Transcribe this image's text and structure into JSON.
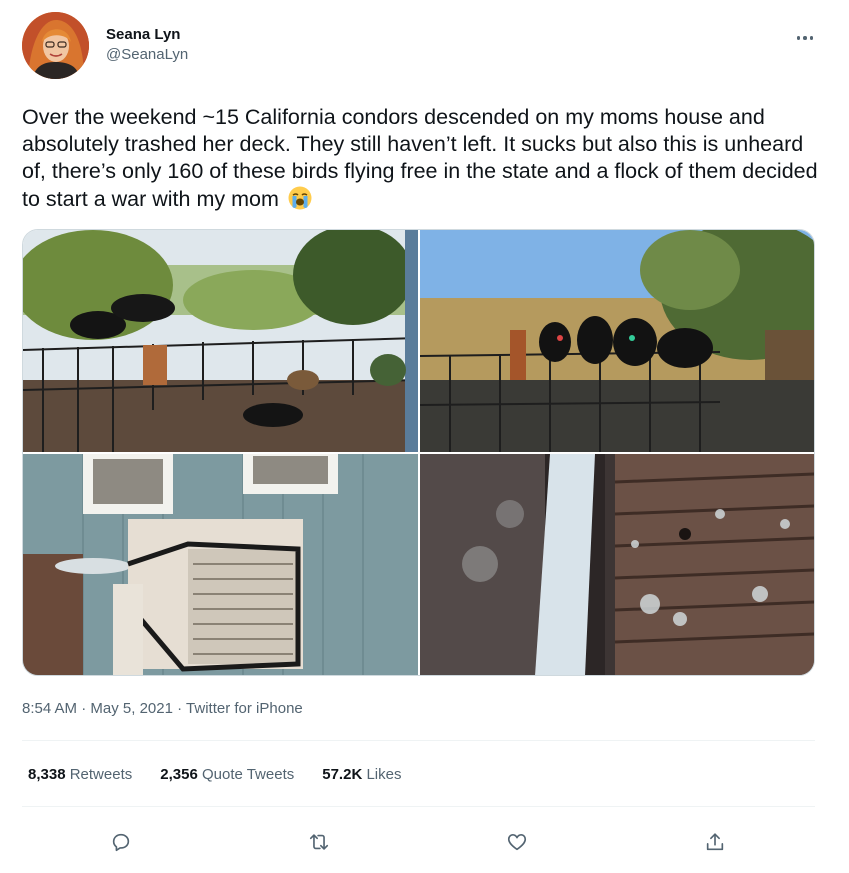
{
  "author": {
    "display_name": "Seana Lyn",
    "handle": "@SeanaLyn"
  },
  "tweet": {
    "text": "Over the weekend ~15 California condors descended on my moms house and absolutely trashed her deck. They still haven’t left. It sucks but also this is unheard of, there’s only 160 of these birds flying free in the state and a flock of them decided to start a war with my mom",
    "emoji": "loudly-crying-face-emoji"
  },
  "media": [
    {
      "name": "photo-condors-on-deck-railing",
      "kind": "image"
    },
    {
      "name": "photo-condors-on-fence",
      "kind": "image"
    },
    {
      "name": "photo-damaged-ac-unit",
      "kind": "image"
    },
    {
      "name": "photo-droppings-on-deck",
      "kind": "image"
    }
  ],
  "meta": {
    "time": "8:54 AM",
    "separator": "·",
    "date": "May 5, 2021",
    "source": "Twitter for iPhone"
  },
  "stats": {
    "retweets_count": "8,338",
    "retweets_label": "Retweets",
    "quotes_count": "2,356",
    "quotes_label": "Quote Tweets",
    "likes_count": "57.2K",
    "likes_label": "Likes"
  },
  "icons": {
    "reply": "reply-icon",
    "retweet": "retweet-icon",
    "like": "heart-icon",
    "share": "share-icon",
    "more": "more-icon"
  },
  "colors": {
    "text": "#0f1419",
    "secondary": "#536471",
    "divider": "#eff3f4",
    "border": "#cfd9de"
  }
}
